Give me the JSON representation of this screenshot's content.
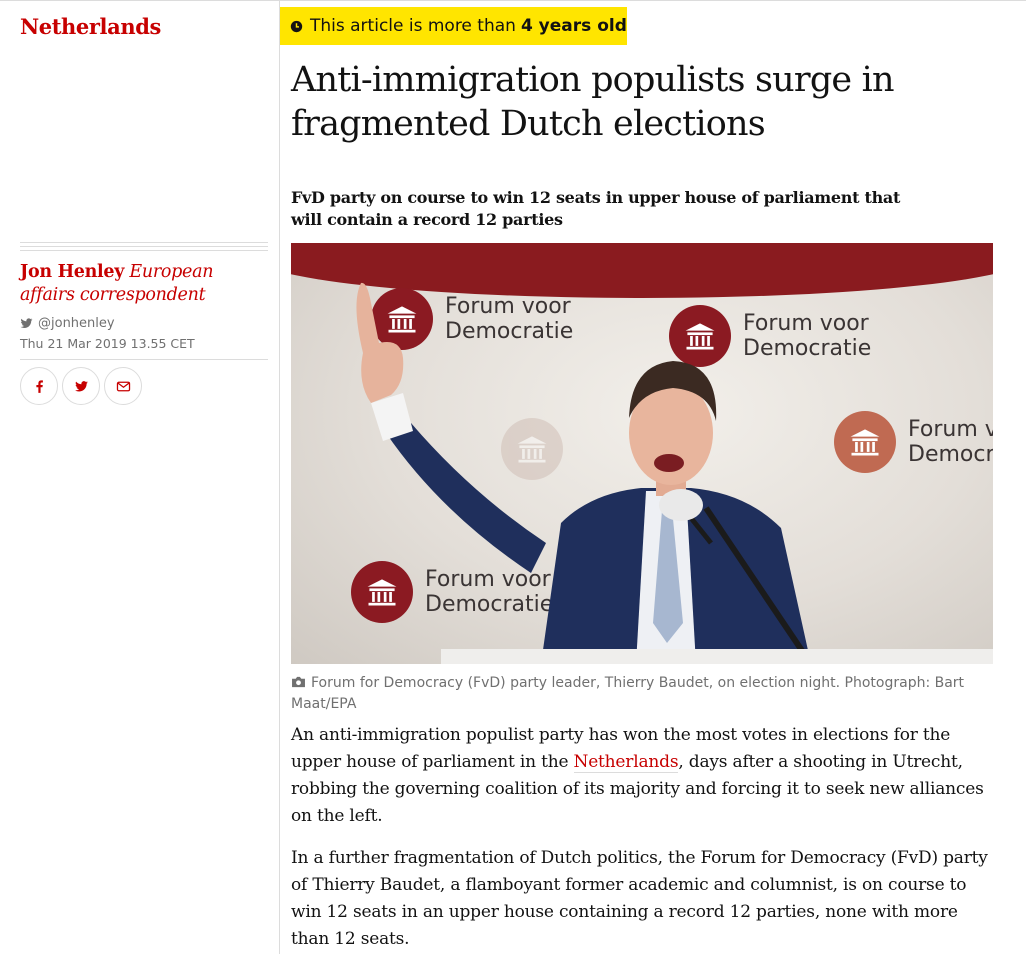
{
  "section": {
    "label": "Netherlands"
  },
  "byline": {
    "name": "Jon Henley",
    "role": "European affairs correspondent",
    "twitter": "@jonhenley",
    "date": "Thu 21 Mar 2019 13.55 CET"
  },
  "share": {
    "icons": [
      "facebook-icon",
      "twitter-icon",
      "email-icon"
    ]
  },
  "age_badge": {
    "prefix": "This article is more than",
    "emphasis": "4 years old",
    "background": "#ffe500"
  },
  "article": {
    "headline": "Anti-immigration populists surge in fragmented Dutch elections",
    "standfirst": "FvD party on course to win 12 seats in upper house of parliament that will contain a record 12 parties",
    "photo": {
      "backdrop_text": "Forum voor Democratie",
      "caption": "Forum for Democracy (FvD) party leader, Thierry Baudet, on election night. Photograph: Bart Maat/EPA"
    },
    "para1": {
      "before_link": "An anti-immigration populist party has won the most votes in elections for the upper house of parliament in the ",
      "link": "Netherlands",
      "after_link": ", days after a shooting in Utrecht, robbing the governing coalition of its majority and forcing it to seek new alliances on the left."
    },
    "para2": "In a further fragmentation of Dutch politics, the Forum for Democracy (FvD) party of Thierry Baudet, a flamboyant former academic and columnist, is on course to win 12 seats in an upper house containing a record 12 parties, none with more than 12 seats."
  },
  "colors": {
    "accent": "#c70000",
    "text": "#121212",
    "muted": "#707070",
    "rule": "#dcdcdc",
    "brand_red": "#8b1a22"
  }
}
